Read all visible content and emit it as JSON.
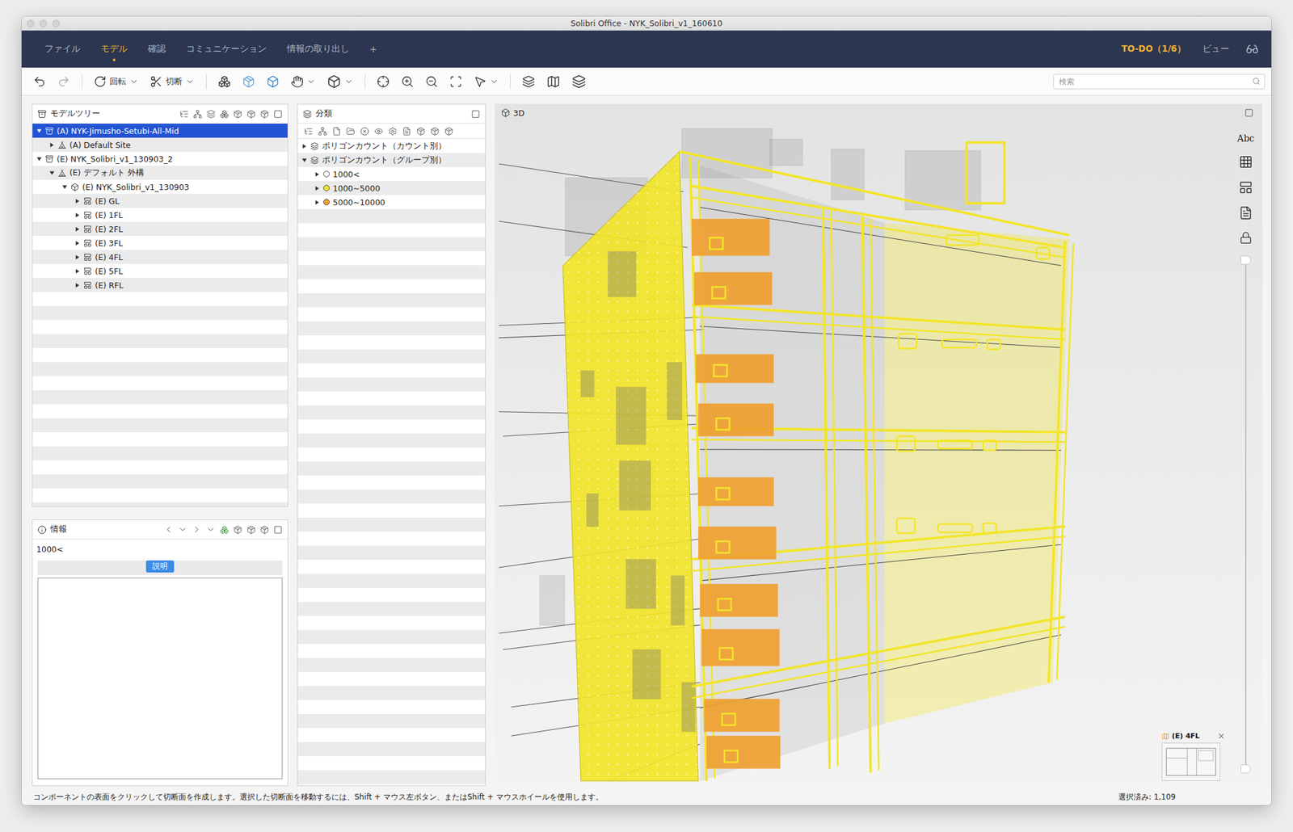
{
  "window": {
    "title": "Solibri Office - NYK_Solibri_v1_160610"
  },
  "menu": {
    "tabs": [
      {
        "label": "ファイル",
        "selected": false
      },
      {
        "label": "モデル",
        "selected": true
      },
      {
        "label": "確認",
        "selected": false
      },
      {
        "label": "コミュニケーション",
        "selected": false
      },
      {
        "label": "情報の取り出し",
        "selected": false
      },
      {
        "label": "+",
        "selected": false
      }
    ],
    "todo": "TO-DO（1/6）",
    "view": "ビュー"
  },
  "toolbar": {
    "rotate": "回転",
    "section": "切断",
    "search_placeholder": "検索"
  },
  "model_tree": {
    "title": "モデルツリー",
    "items": [
      {
        "label": "(A) NYK-Jimusho-Setubi-All-Mid",
        "level": 0,
        "kind": "model",
        "expanded": true,
        "selected": true
      },
      {
        "label": "(A) Default Site",
        "level": 1,
        "kind": "site",
        "expanded": false,
        "selected": false
      },
      {
        "label": "(E) NYK_Solibri_v1_130903_2",
        "level": 0,
        "kind": "model",
        "expanded": true,
        "selected": false
      },
      {
        "label": "(E) デフォルト 外構",
        "level": 1,
        "kind": "site",
        "expanded": true,
        "selected": false
      },
      {
        "label": "(E) NYK_Solibri_v1_130903",
        "level": 2,
        "kind": "building",
        "expanded": true,
        "selected": false
      },
      {
        "label": "(E) GL",
        "level": 3,
        "kind": "storey",
        "expanded": false,
        "selected": false
      },
      {
        "label": "(E) 1FL",
        "level": 3,
        "kind": "storey",
        "expanded": false,
        "selected": false
      },
      {
        "label": "(E) 2FL",
        "level": 3,
        "kind": "storey",
        "expanded": false,
        "selected": false
      },
      {
        "label": "(E) 3FL",
        "level": 3,
        "kind": "storey",
        "expanded": false,
        "selected": false
      },
      {
        "label": "(E) 4FL",
        "level": 3,
        "kind": "storey",
        "expanded": false,
        "selected": false
      },
      {
        "label": "(E) 5FL",
        "level": 3,
        "kind": "storey",
        "expanded": false,
        "selected": false
      },
      {
        "label": "(E) RFL",
        "level": 3,
        "kind": "storey",
        "expanded": false,
        "selected": false
      }
    ]
  },
  "classification": {
    "title": "分類",
    "items": [
      {
        "label": "ポリゴンカウント（カウント別）",
        "level": 0,
        "kind": "group",
        "expanded": false
      },
      {
        "label": "ポリゴンカウント（グループ別）",
        "level": 0,
        "kind": "group",
        "expanded": true
      },
      {
        "label": "1000<",
        "level": 1,
        "kind": "class",
        "expanded": false,
        "color": "#ffffff"
      },
      {
        "label": "1000~5000",
        "level": 1,
        "kind": "class",
        "expanded": false,
        "color": "#f2e52a"
      },
      {
        "label": "5000~10000",
        "level": 1,
        "kind": "class",
        "expanded": false,
        "color": "#f0a030"
      }
    ]
  },
  "info": {
    "title": "情報",
    "value": "1000<",
    "button": "説明"
  },
  "view3d": {
    "title": "3D",
    "side_label": "Abc",
    "slider": {
      "low": 0,
      "high": 1
    },
    "minimap": {
      "label": "(E) 4FL"
    }
  },
  "status_bar": {
    "hint": "コンポーネントの表面をクリックして切断面を作成します。選択した切断面を移動するには、Shift + マウス左ボタン、またはShift + マウスホイールを使用します。",
    "selection": "選択済み: 1,109"
  }
}
